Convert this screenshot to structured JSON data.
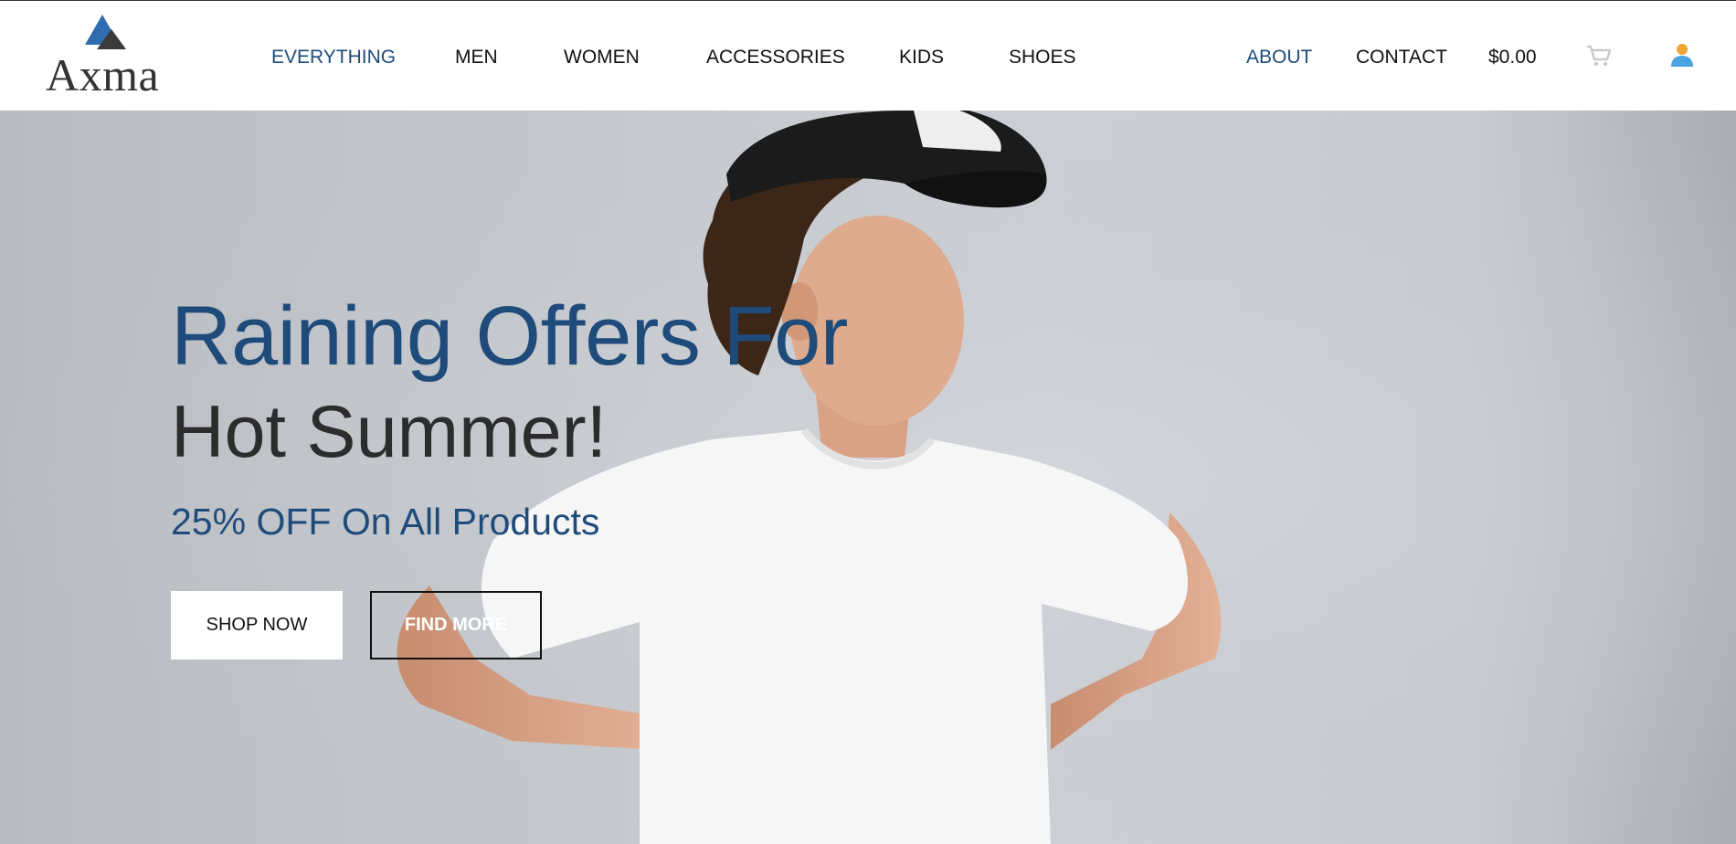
{
  "brand": {
    "name": "Axma",
    "logo_icon": "triangle-mountain-icon"
  },
  "nav": {
    "items": [
      {
        "label": "EVERYTHING",
        "active": true
      },
      {
        "label": "MEN",
        "active": false
      },
      {
        "label": "WOMEN",
        "active": false
      },
      {
        "label": "ACCESSORIES",
        "active": false
      },
      {
        "label": "KIDS",
        "active": false
      },
      {
        "label": "SHOES",
        "active": false
      }
    ],
    "right": {
      "about": "ABOUT",
      "contact": "CONTACT",
      "cart_total": "$0.00",
      "cart_icon": "shopping-cart-icon",
      "account_icon": "user-icon"
    }
  },
  "hero": {
    "headline_line1": "Raining Offers For",
    "headline_line2": "Hot Summer!",
    "subline": "25% OFF On All Products",
    "shop_now": "SHOP NOW",
    "find_more": "FIND MORE"
  },
  "colors": {
    "accent": "#1f4b7b",
    "text_dark": "#111111",
    "hero_bg": "#c8ccd1",
    "account_icon": "#4aa3df"
  }
}
